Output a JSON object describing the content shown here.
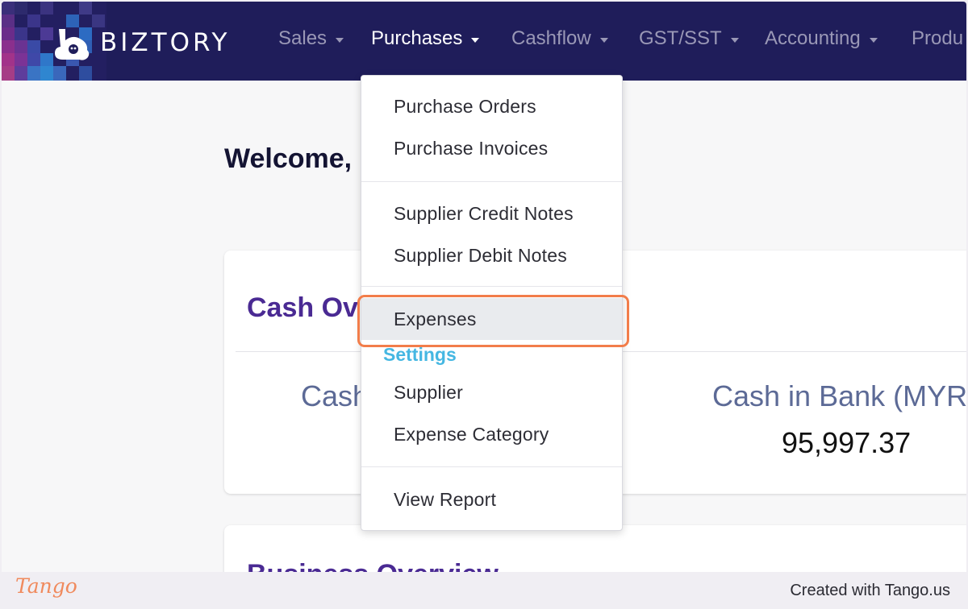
{
  "brand": {
    "name": "BIZTORY"
  },
  "colors": {
    "navbar_bg": "#1f1d5a",
    "nav_active": "#ffffff",
    "nav_inactive": "#9a98b6",
    "card_title": "#4a2a93",
    "settings_heading": "#45b7e2",
    "highlight_ring": "#f27d4a",
    "tango_brand": "#f08a5d"
  },
  "nav": {
    "items": [
      {
        "label": "Sales",
        "active": false
      },
      {
        "label": "Purchases",
        "active": true
      },
      {
        "label": "Cashflow",
        "active": false
      },
      {
        "label": "GST/SST",
        "active": false
      },
      {
        "label": "Accounting",
        "active": false
      },
      {
        "label": "Produ",
        "active": false
      }
    ]
  },
  "page": {
    "welcome": "Welcome,"
  },
  "cash_overview": {
    "title": "Cash Ov",
    "cash_label": "Cash",
    "bank_label": "Cash in Bank (MYR",
    "bank_value": "95,997.37"
  },
  "business_overview": {
    "title": "Business Overview"
  },
  "dropdown": {
    "purchase_orders": "Purchase Orders",
    "purchase_invoices": "Purchase Invoices",
    "supplier_credit_notes": "Supplier Credit Notes",
    "supplier_debit_notes": "Supplier Debit Notes",
    "expenses": "Expenses",
    "settings_heading": "Settings",
    "supplier": "Supplier",
    "expense_category": "Expense Category",
    "view_report": "View Report"
  },
  "footer": {
    "logo": "Tango",
    "credits": "Created with Tango.us"
  }
}
